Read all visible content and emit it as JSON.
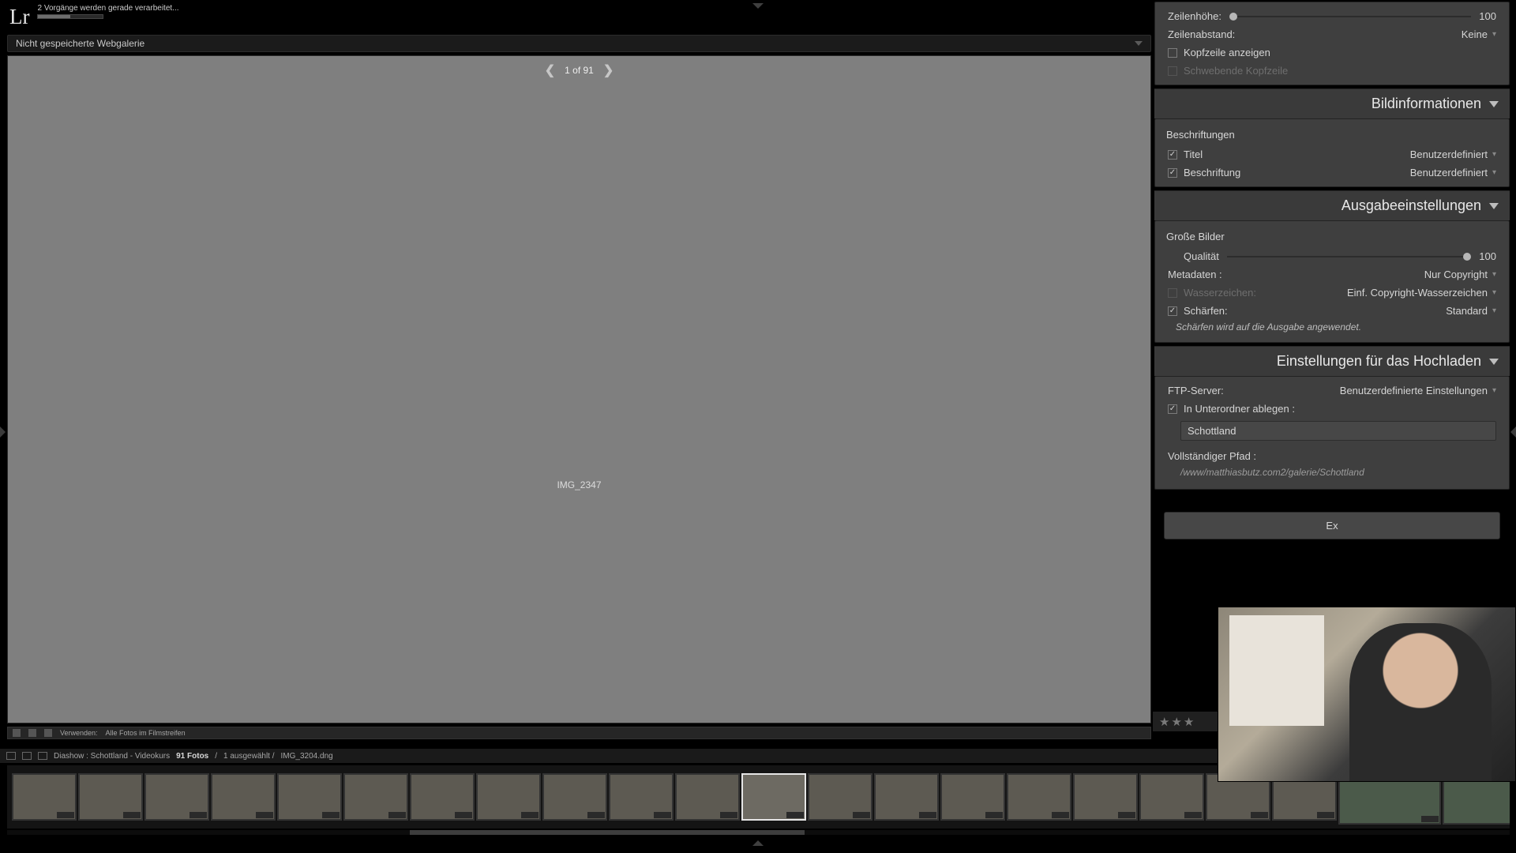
{
  "app": {
    "logo": "Lr",
    "status": "2 Vorgänge werden gerade verarbeitet..."
  },
  "subheader": {
    "title": "Nicht gespeicherte Webgalerie"
  },
  "preview": {
    "pager_text": "1 of 91",
    "image_name": "IMG_2347"
  },
  "panel_top": {
    "row_height_label": "Zeilenhöhe:",
    "row_height_value": "100",
    "row_spacing_label": "Zeilenabstand:",
    "row_spacing_value": "Keine",
    "show_header_label": "Kopfzeile anzeigen",
    "floating_header_label": "Schwebende Kopfzeile"
  },
  "section_bildinfo": {
    "title": "Bildinformationen",
    "captions_subhead": "Beschriftungen",
    "title_row_label": "Titel",
    "title_row_value": "Benutzerdefiniert",
    "caption_row_label": "Beschriftung",
    "caption_row_value": "Benutzerdefiniert"
  },
  "section_output": {
    "title": "Ausgabeeinstellungen",
    "large_images_subhead": "Große Bilder",
    "quality_label": "Qualität",
    "quality_value": "100",
    "metadata_label": "Metadaten :",
    "metadata_value": "Nur Copyright",
    "watermark_label": "Wasserzeichen:",
    "watermark_value": "Einf. Copyright-Wasserzeichen",
    "sharpen_label": "Schärfen:",
    "sharpen_value": "Standard",
    "sharpen_note": "Schärfen wird auf die Ausgabe angewendet."
  },
  "section_upload": {
    "title": "Einstellungen für das Hochladen",
    "ftp_label": "FTP-Server:",
    "ftp_value": "Benutzerdefinierte Einstellungen",
    "subfolder_label": "In Unterordner ablegen :",
    "subfolder_value": "Schottland",
    "fullpath_label": "Vollständiger Pfad :",
    "fullpath_value": "/www/matthiasbutz.com2/galerie/Schottland"
  },
  "export_btn": "Ex",
  "toolbar1": {
    "use_label": "Verwenden:",
    "use_value": "Alle Fotos im Filmstreifen"
  },
  "crumb": {
    "path": "Diashow : Schottland - Videokurs",
    "count": "91 Fotos",
    "sep": "/",
    "selected": "1 ausgewählt /",
    "current": "IMG_3204.dng"
  },
  "thumb_count": 25
}
